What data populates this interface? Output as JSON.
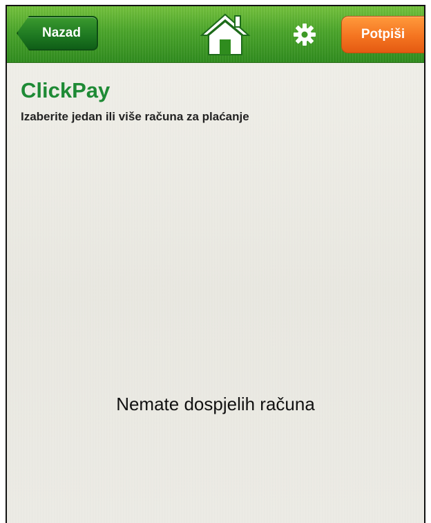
{
  "header": {
    "back_label": "Nazad",
    "home_icon": "home-icon",
    "settings_icon": "gear-icon",
    "sign_label": "Potpiši"
  },
  "main": {
    "title": "ClickPay",
    "subtitle": "Izaberite jedan ili više računa za plaćanje",
    "empty_message": "Nemate dospjelih računa"
  },
  "colors": {
    "header_green": "#4aa52a",
    "back_button_green": "#1f7a22",
    "sign_button_orange": "#f47420",
    "title_green": "#1e8a35"
  }
}
